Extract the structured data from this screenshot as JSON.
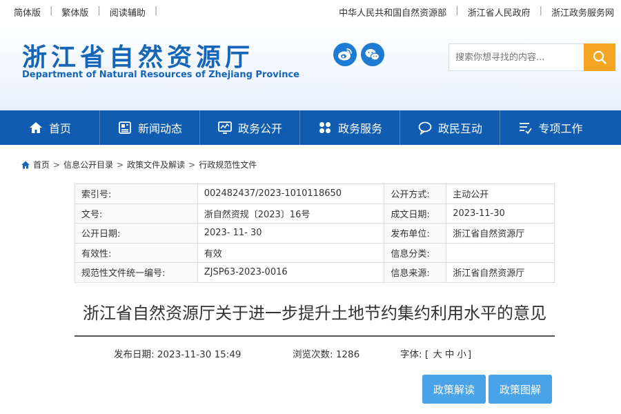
{
  "topbar": {
    "left_links": [
      "简体版",
      "繁体版",
      "阅读辅助"
    ],
    "right_links": [
      "中华人民共和国自然资源部",
      "浙江省人民政府",
      "浙江政务服务网"
    ]
  },
  "header": {
    "title_cn": "浙江省自然资源厅",
    "title_en": "Department of Natural Resources of Zhejiang Province",
    "social_icons": [
      "weibo-icon",
      "wechat-icon"
    ],
    "search_placeholder": "搜索你想寻找的内容..."
  },
  "nav": {
    "items": [
      {
        "label": "首页",
        "icon": "home-icon"
      },
      {
        "label": "新闻动态",
        "icon": "news-icon"
      },
      {
        "label": "政务公开",
        "icon": "monitor-icon"
      },
      {
        "label": "政务服务",
        "icon": "grid-icon"
      },
      {
        "label": "政民互动",
        "icon": "chat-icon"
      },
      {
        "label": "专项工作",
        "icon": "checklist-icon"
      }
    ]
  },
  "breadcrumb": [
    "首页",
    "信息公开目录",
    "政策文件及解读",
    "行政规范性文件"
  ],
  "info_table": {
    "rows": [
      [
        "索引号:",
        "002482437/2023-1010118650",
        "公开方式:",
        "主动公开"
      ],
      [
        "文号:",
        "浙自然资规〔2023〕16号",
        "成文日期:",
        "2023-11-30"
      ],
      [
        "公开日期:",
        "2023- 11- 30",
        "发布单位:",
        "浙江省自然资源厅"
      ],
      [
        "有效性:",
        "有效",
        "信息分类:",
        ""
      ],
      [
        "规范性文件统一编号:",
        "ZJSP63-2023-0016",
        "信息来源:",
        "浙江省自然资源厅"
      ]
    ]
  },
  "document": {
    "title": "浙江省自然资源厅关于进一步提升土地节约集约利用水平的意见",
    "publish_date": "发布日期: 2023-11-30 15:49",
    "views": "浏览次数: 1286",
    "font_label": "字体:",
    "font_sizes": [
      "大",
      "中",
      "小"
    ]
  },
  "buttons": {
    "policy_interpretation": "政策解读",
    "policy_graphic": "政策图解"
  },
  "colors": {
    "brand_blue": "#1565b8",
    "nav_bg": "#0f5cb0",
    "search_button": "#f5a623",
    "policy_button": "#4aa3e6"
  }
}
